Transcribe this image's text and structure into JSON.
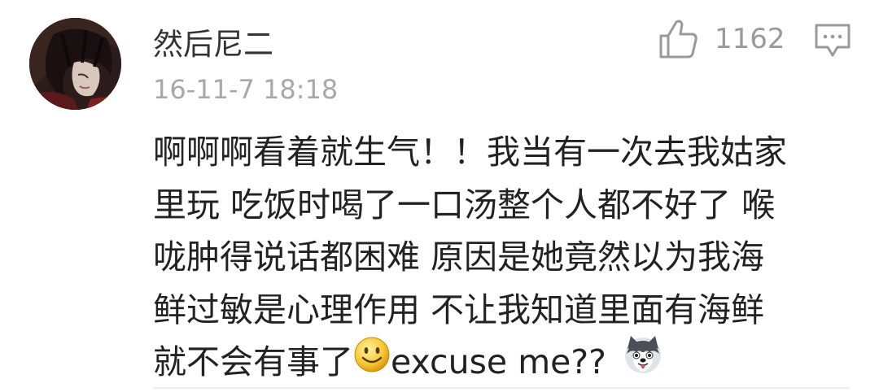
{
  "comment": {
    "username": "然后尼二",
    "timestamp": "16-11-7 18:18",
    "likes": "1162",
    "like_icon": "thumbs-up-icon",
    "reply_icon": "comment-bubble-icon",
    "text_lines": [
      "啊啊啊看着就生气！！我当有一次去我姑家",
      "里玩 吃饭时喝了一口汤整个人都不好了 喉",
      "咙肿得说话都困难 原因是她竟然以为我海",
      "鲜过敏是心理作用 不让我知道里面有海鲜"
    ],
    "last_line": {
      "before": "就不会有事了",
      "smile_emoji": "smile-emoji-icon",
      "after": "excuse me??",
      "husky_emoji": "husky-emoji-icon"
    }
  }
}
